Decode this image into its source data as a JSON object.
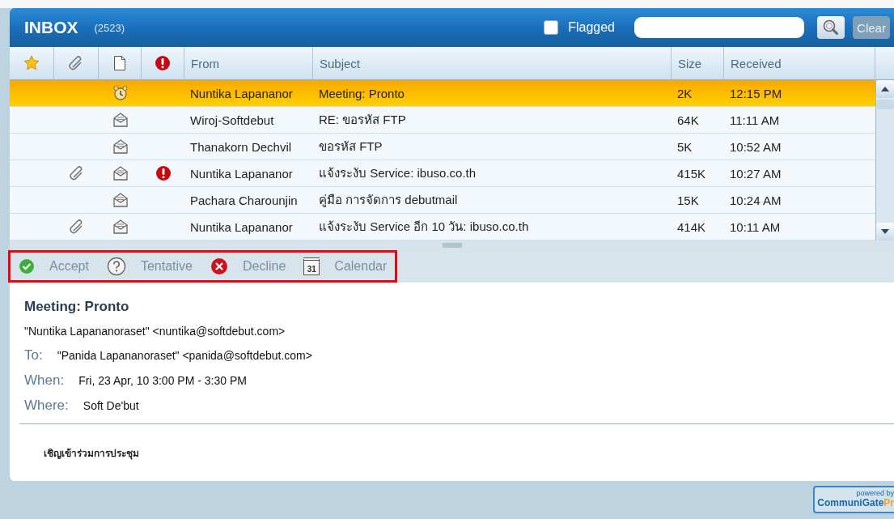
{
  "header": {
    "title": "INBOX",
    "count": "(2523)",
    "flagged": {
      "label": "Flagged",
      "checked": false
    },
    "clear": {
      "label": "Clear",
      "disabled": true
    }
  },
  "table": {
    "columns": [
      {
        "kind": "star"
      },
      {
        "kind": "attachment"
      },
      {
        "kind": "document"
      },
      {
        "kind": "priority"
      },
      {
        "kind": "text",
        "label": "From"
      },
      {
        "kind": "text",
        "label": "Subject"
      },
      {
        "kind": "text",
        "label": "Size"
      },
      {
        "kind": "text",
        "label": "Received"
      }
    ],
    "rows": [
      {
        "selected": true,
        "attachment": false,
        "kind": "alarm",
        "priority": false,
        "from": "Nuntika Lapananor",
        "subject": "Meeting: Pronto",
        "size": "2K",
        "received": "12:15 PM"
      },
      {
        "selected": false,
        "attachment": false,
        "kind": "envelope",
        "priority": false,
        "from": "Wiroj-Softdebut",
        "subject": "RE: ขอรหัส FTP",
        "size": "64K",
        "received": "11:11 AM"
      },
      {
        "selected": false,
        "attachment": false,
        "kind": "envelope",
        "priority": false,
        "from": "Thanakorn Dechvil",
        "subject": "ขอรหัส FTP",
        "size": "5K",
        "received": "10:52 AM"
      },
      {
        "selected": false,
        "attachment": true,
        "kind": "envelope",
        "priority": true,
        "from": "Nuntika Lapananor",
        "subject": "แจ้งระงับ Service: ibuso.co.th",
        "size": "415K",
        "received": "10:27 AM"
      },
      {
        "selected": false,
        "attachment": false,
        "kind": "envelope",
        "priority": false,
        "from": "Pachara Charounjin",
        "subject": "คู่มือ การจัดการ debutmail",
        "size": "15K",
        "received": "10:24 AM"
      },
      {
        "selected": false,
        "attachment": true,
        "kind": "envelope",
        "priority": false,
        "from": "Nuntika Lapananor",
        "subject": "แจ้งระงับ Service อีก 10 วัน: ibuso.co.th",
        "size": "414K",
        "received": "10:11 AM"
      }
    ]
  },
  "toolbar": [
    {
      "kind": "accept",
      "label": "Accept"
    },
    {
      "kind": "tentative",
      "label": "Tentative"
    },
    {
      "kind": "decline",
      "label": "Decline"
    },
    {
      "kind": "calendar",
      "label": "Calendar",
      "icon_text": "31"
    }
  ],
  "message": {
    "title": "Meeting: Pronto",
    "from": "\"Nuntika Lapananoraset\" <nuntika@softdebut.com>",
    "fields": [
      {
        "label": "To:",
        "value": "\"Panida Lapananoraset\" <panida@softdebut.com>"
      },
      {
        "label": "When:",
        "value": "Fri, 23 Apr, 10 3:00 PM - 3:30 PM"
      },
      {
        "label": "Where:",
        "value": "Soft De'but"
      }
    ],
    "body": "เชิญเข้าร่วมการประชุม"
  },
  "footer": {
    "powered": "powered by",
    "name": "CommuniGate",
    "suffix": "Pr"
  }
}
